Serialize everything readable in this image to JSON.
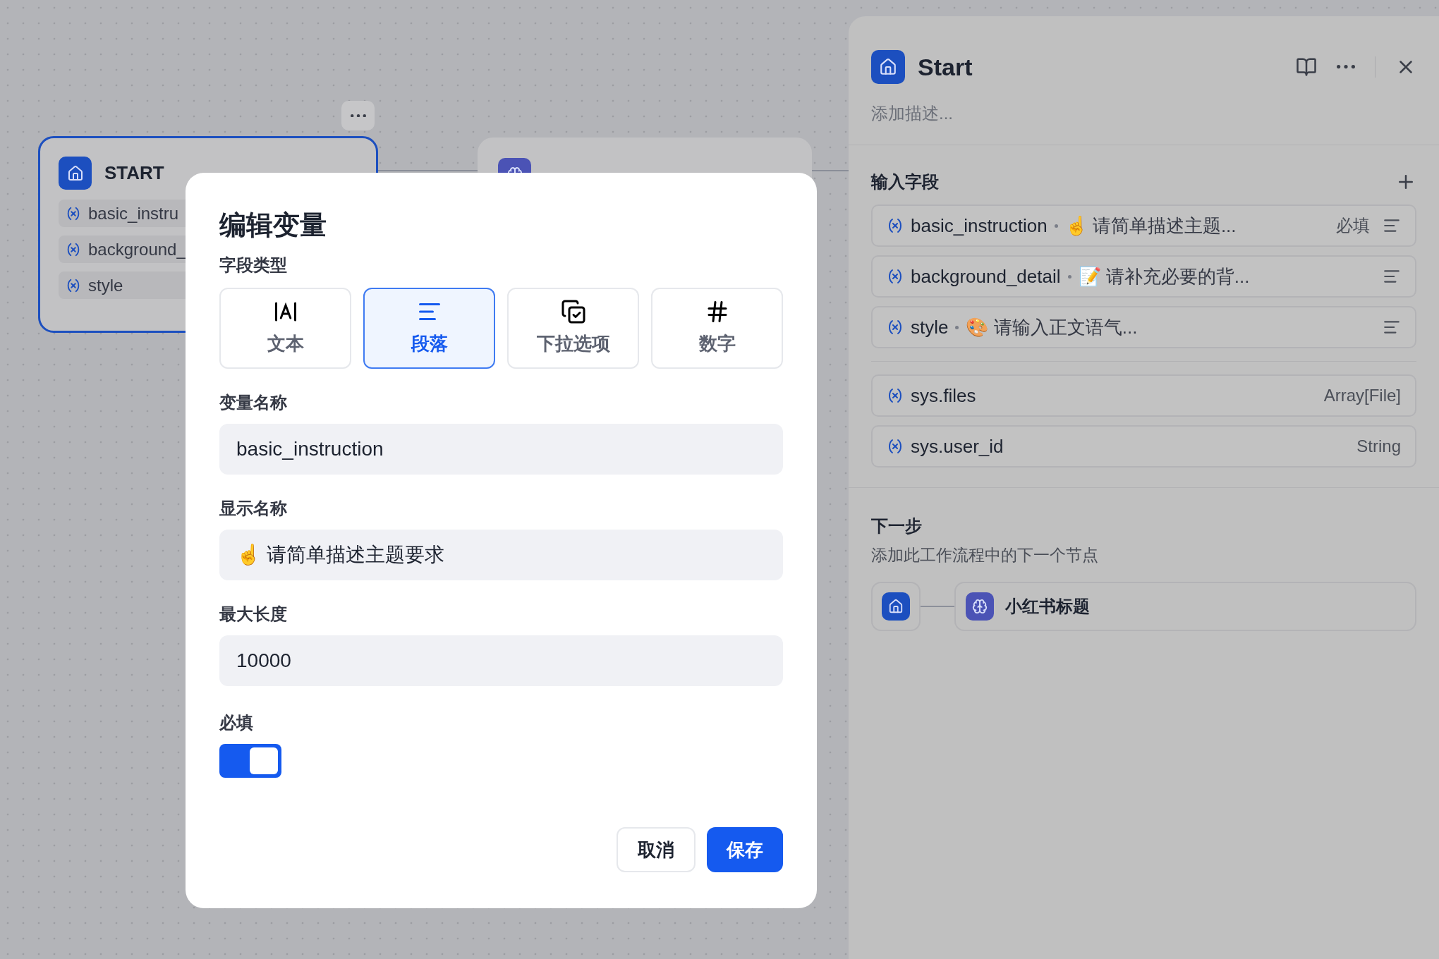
{
  "canvas": {
    "nodes": [
      {
        "kind": "start",
        "title": "START",
        "selected": true,
        "variables": [
          "basic_instru",
          "background_",
          "style"
        ]
      },
      {
        "kind": "llm",
        "selected": false
      }
    ]
  },
  "panel": {
    "title": "Start",
    "description_placeholder": "添加描述...",
    "inputs_title": "输入字段",
    "inputs": [
      {
        "name": "basic_instruction",
        "label": "☝ 请简单描述主题...",
        "badge": "必填"
      },
      {
        "name": "background_detail",
        "label": "📝 请补充必要的背..."
      },
      {
        "name": "style",
        "label": "🎨 请输入正文语气..."
      }
    ],
    "system_vars": [
      {
        "name": "sys.files",
        "type": "Array[File]"
      },
      {
        "name": "sys.user_id",
        "type": "String"
      }
    ],
    "next_step": {
      "title": "下一步",
      "subtitle": "添加此工作流程中的下一个节点",
      "node": "小红书标题"
    }
  },
  "dialog": {
    "title": "编辑变量",
    "field_type_label": "字段类型",
    "field_types": [
      {
        "kind": "text",
        "label": "文本",
        "selected": false
      },
      {
        "kind": "paragraph",
        "label": "段落",
        "selected": true
      },
      {
        "kind": "select",
        "label": "下拉选项",
        "selected": false
      },
      {
        "kind": "number",
        "label": "数字",
        "selected": false
      }
    ],
    "fields": [
      {
        "label": "变量名称",
        "value": "basic_instruction"
      },
      {
        "label": "显示名称",
        "value": "☝ 请简单描述主题要求"
      },
      {
        "label": "最大长度",
        "value": "10000"
      }
    ],
    "required": {
      "label": "必填",
      "on": true
    },
    "buttons": [
      {
        "kind": "cancel",
        "label": "取消"
      },
      {
        "kind": "primary",
        "label": "保存"
      }
    ]
  }
}
